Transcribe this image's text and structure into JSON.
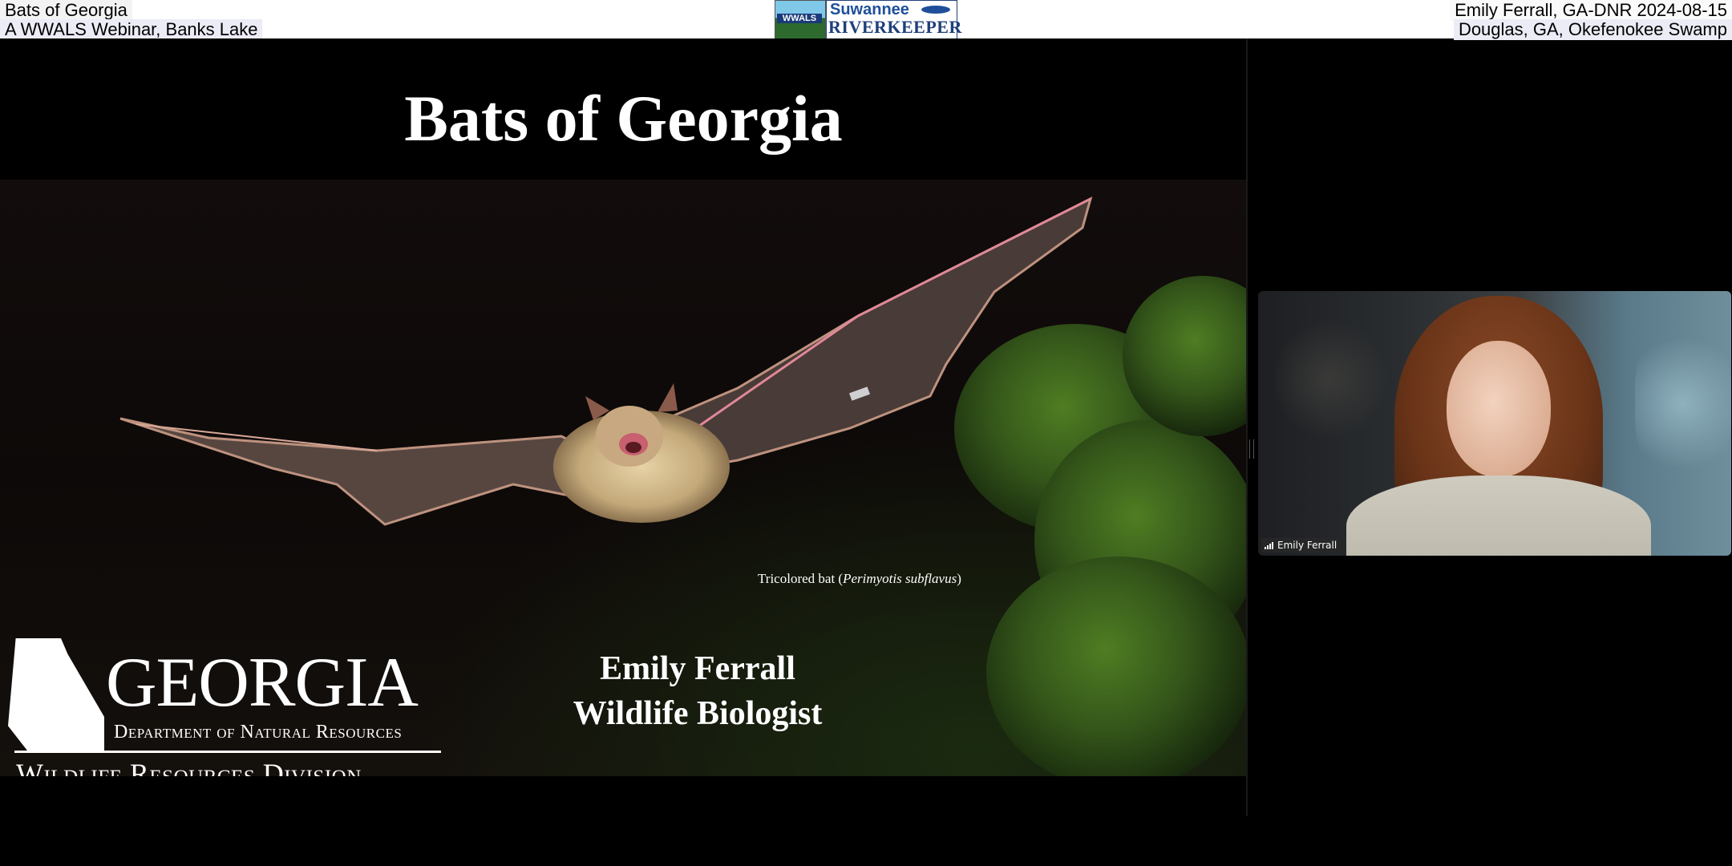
{
  "header": {
    "left_line1": "Bats of Georgia",
    "left_line2": "A WWALS Webinar, Banks Lake",
    "right_line1": "Emily Ferrall, GA-DNR 2024-08-15",
    "right_line2": "Douglas, GA, Okefenokee Swamp",
    "logo_wwals_text": "WWALS",
    "logo_riverkeeper_line1": "Suwannee",
    "logo_riverkeeper_line2": "RIVERKEEPER"
  },
  "slide": {
    "title": "Bats of Georgia",
    "caption_prefix": "Tricolored bat (",
    "caption_species": "Perimyotis subflavus",
    "caption_suffix": ")",
    "presenter_name": "Emily Ferrall",
    "presenter_role": "Wildlife Biologist",
    "logo_georgia": "GEORGIA",
    "logo_department": "Department of Natural Resources",
    "logo_division": "Wildlife Resources Division"
  },
  "video": {
    "participant_name": "Emily Ferrall"
  },
  "colors": {
    "background": "#000000",
    "slide_text": "#ffffff",
    "riverkeeper_blue": "#1f4f9a"
  },
  "icons": [
    "signal-strength-icon",
    "bat-image",
    "georgia-state-outline-icon"
  ]
}
